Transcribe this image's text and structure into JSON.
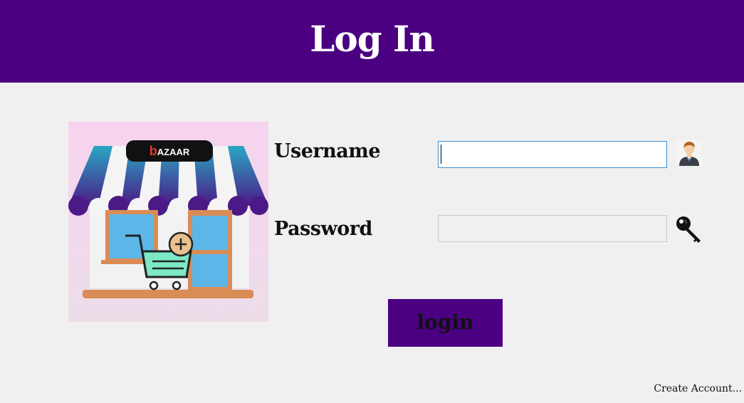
{
  "header": {
    "title": "Log In"
  },
  "logo": {
    "brand_text": "bAZAAR"
  },
  "form": {
    "username_label": "Username",
    "username_value": "",
    "password_label": "Password",
    "password_value": "",
    "login_label": "login"
  },
  "footer": {
    "create_account": "Create Account..."
  },
  "colors": {
    "accent": "#4b0082",
    "background": "#f0f0f0"
  },
  "icons": {
    "user": "user-avatar-icon",
    "key": "key-icon",
    "cart": "shopping-cart-icon"
  }
}
